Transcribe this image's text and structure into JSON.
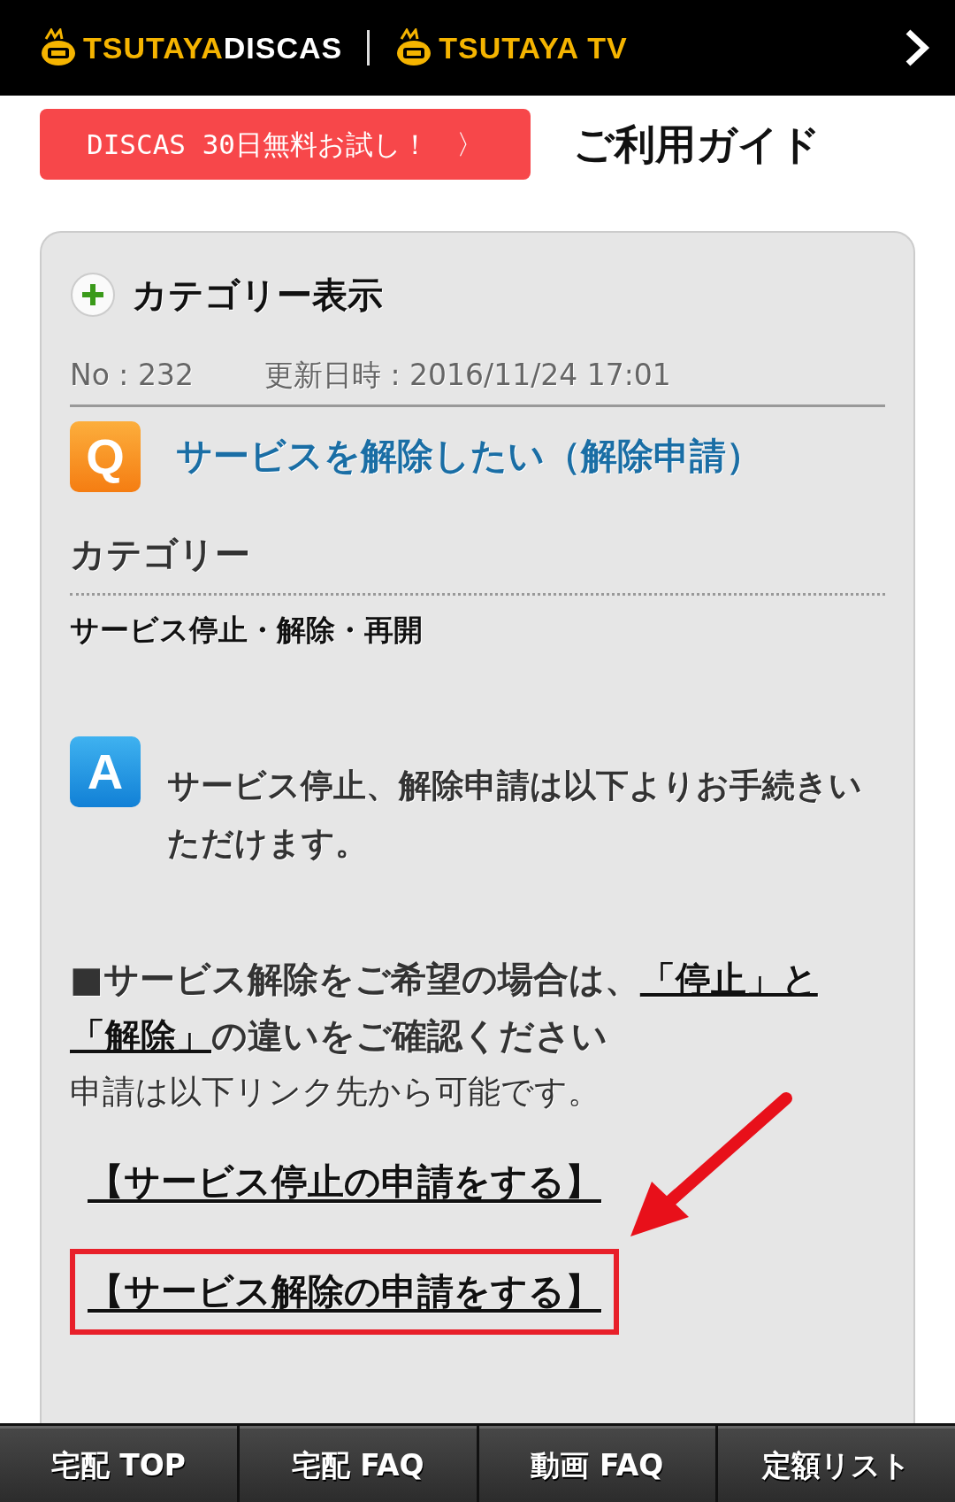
{
  "header": {
    "logos": [
      {
        "parts": [
          {
            "text": "TSUTAYA",
            "color": "#f5b400"
          },
          {
            "text": "DISCAS",
            "color": "#ffffff"
          }
        ]
      },
      {
        "parts": [
          {
            "text": "TSUTAYA TV",
            "color": "#f5b400"
          }
        ]
      }
    ]
  },
  "trial_button": "DISCAS 30日無料お試し！　〉",
  "page_title": "ご利用ガイド",
  "faq": {
    "category_toggle": "カテゴリー表示",
    "number": "No : 232",
    "updated": "更新日時 : 2016/11/24 17:01",
    "question_badge": "Q",
    "question": "サービスを解除したい（解除申請）",
    "category_heading": "カテゴリー",
    "category": "サービス停止・解除・再開",
    "answer_badge": "A",
    "answer": "サービス停止、解除申請は以下よりお手続きいただけます。",
    "notice": [
      {
        "text": "■サービス解除をご希望の場合は、",
        "link": false
      },
      {
        "text": "「停止」と",
        "link": true
      },
      {
        "text": "「解除」",
        "link": true
      },
      {
        "text": "の違いをご確認ください",
        "link": false
      }
    ],
    "note": "申請は以下リンク先から可能です。",
    "application_links": [
      {
        "text": "【サービス停止の申請をする】",
        "highlighted": false
      },
      {
        "text": "【サービス解除の申請をする】",
        "highlighted": true
      }
    ]
  },
  "bottom_nav": [
    "宅配 TOP",
    "宅配 FAQ",
    "動画 FAQ",
    "定額リスト"
  ]
}
